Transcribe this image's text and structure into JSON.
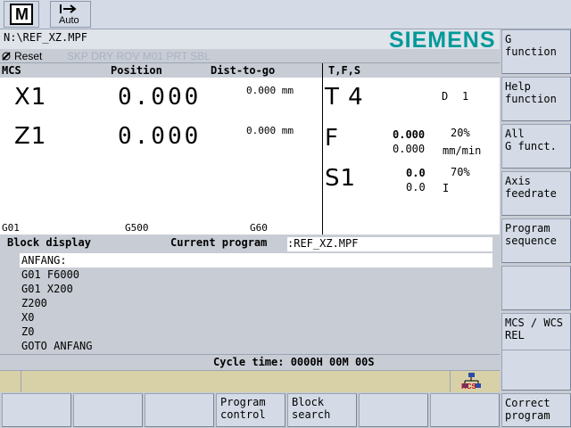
{
  "top": {
    "mode_label": "M",
    "auto_label": "Auto"
  },
  "path": "N:\\REF_XZ.MPF",
  "brand": "SIEMENS",
  "status": {
    "reset": "Reset",
    "flags": "SKP DRY ROV M01 PRT SBL"
  },
  "positions": {
    "header": {
      "mcs": "MCS",
      "position": "Position",
      "dtg": "Dist-to-go"
    },
    "axes": [
      {
        "name": "X1",
        "value": "0.000",
        "dtg": "0.000 mm"
      },
      {
        "name": "Z1",
        "value": "0.000",
        "dtg": "0.000 mm"
      }
    ],
    "gcodes": [
      "G01",
      "G500",
      "G60"
    ]
  },
  "tfs": {
    "header": "T,F,S",
    "tool": "T 4",
    "d_label": "D",
    "d_value": "1",
    "feed": {
      "label": "F",
      "actual": "0.000",
      "set": "0.000",
      "pct": "20%",
      "unit": "mm/min"
    },
    "spindle": {
      "label": "S1",
      "actual": "0.0",
      "set": "0.0",
      "pct": "70%",
      "unit": "I"
    }
  },
  "block": {
    "title": "Block display",
    "current_label": "Current program",
    "current_value": ":REF_XZ.MPF",
    "lines": [
      "ANFANG:",
      "G01 F6000",
      "G01 X200",
      "Z200",
      "X0",
      "Z0",
      "GOTO ANFANG"
    ]
  },
  "cycle_time": "Cycle time: 0000H 00M 00S",
  "rcs_label": "RCS",
  "softkeys_v": [
    {
      "line1": "G",
      "line2": "function"
    },
    {
      "line1": "Help",
      "line2": "function"
    },
    {
      "line1": "All",
      "line2": "G funct."
    },
    {
      "line1": "Axis",
      "line2": "feedrate"
    },
    {
      "line1": "Program",
      "line2": "sequence"
    },
    {
      "line1": "",
      "line2": ""
    },
    {
      "line1": "MCS / WCS",
      "line2": "REL"
    },
    {
      "line1": "",
      "line2": ""
    },
    {
      "line1": "Correct",
      "line2": "program"
    }
  ],
  "softkeys_h": [
    {
      "line1": "",
      "line2": ""
    },
    {
      "line1": "",
      "line2": ""
    },
    {
      "line1": "",
      "line2": ""
    },
    {
      "line1": "Program",
      "line2": "control"
    },
    {
      "line1": "Block",
      "line2": "search"
    },
    {
      "line1": "",
      "line2": ""
    },
    {
      "line1": "",
      "line2": ""
    }
  ],
  "colors": {
    "brand": "#009999",
    "panel_bg": "#c8ccd4",
    "softkey_bg": "#d4dbe6",
    "msg_row": "#d8d1a8"
  }
}
